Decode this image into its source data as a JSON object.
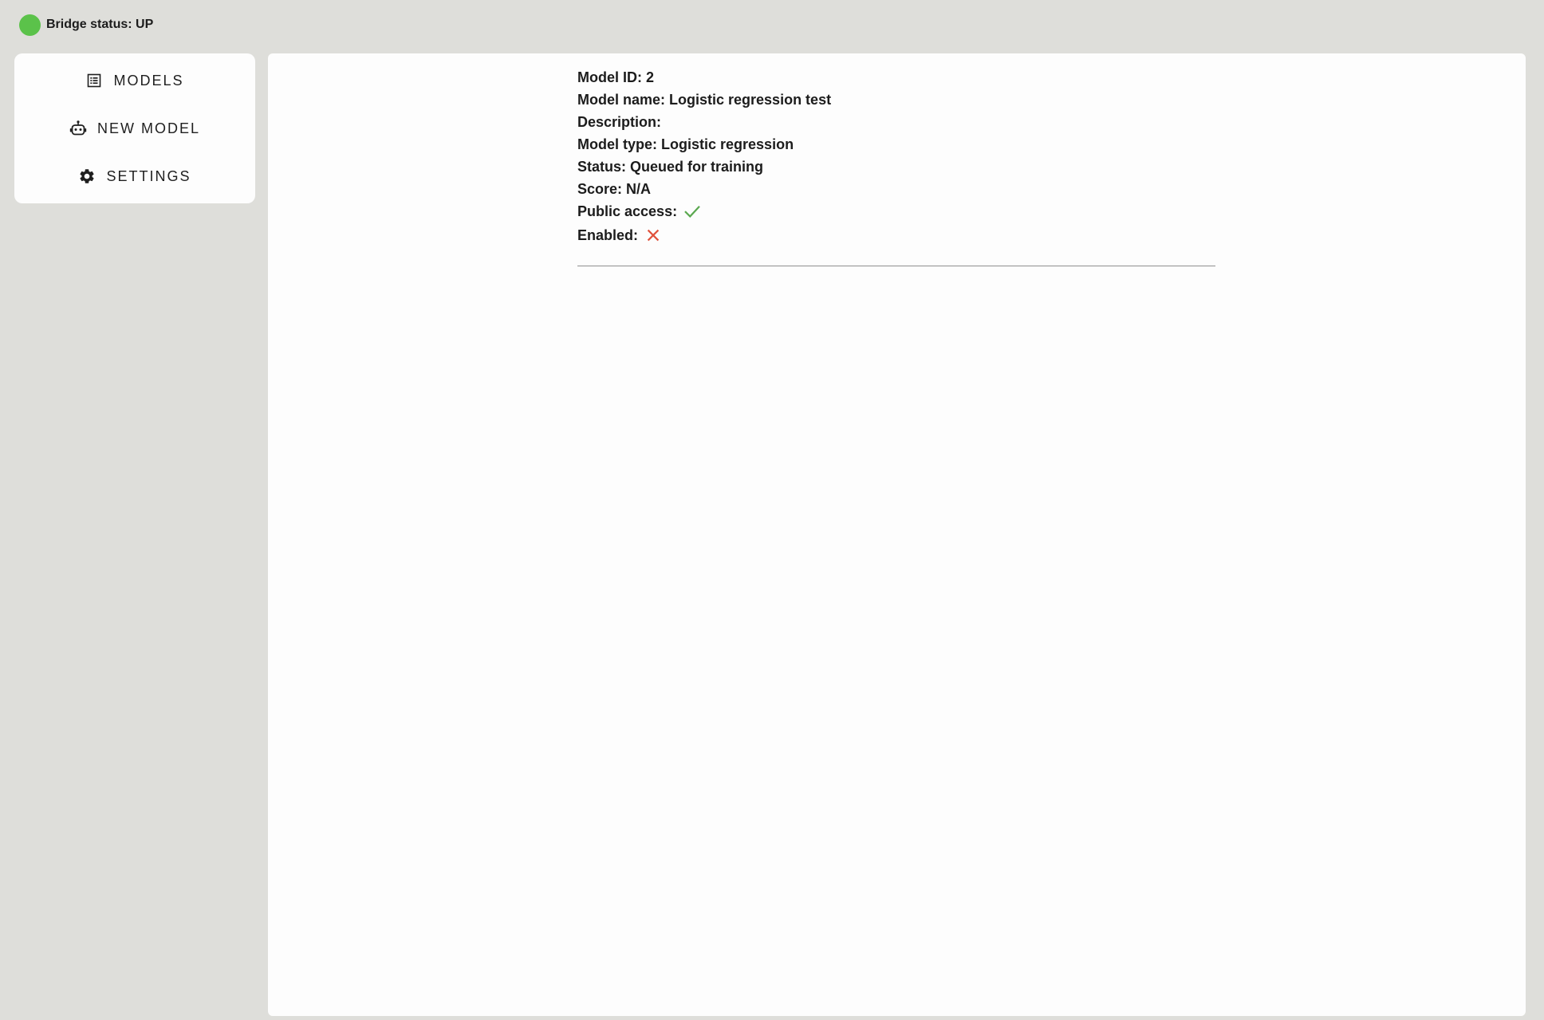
{
  "bridge": {
    "label": "Bridge status:",
    "value": "UP",
    "color": "#5bc24a"
  },
  "sidebar": {
    "items": [
      {
        "label": "MODELS",
        "icon": "list-icon"
      },
      {
        "label": "NEW MODEL",
        "icon": "robot-icon"
      },
      {
        "label": "SETTINGS",
        "icon": "gear-icon"
      }
    ]
  },
  "model": {
    "id_label": "Model ID:",
    "id": "2",
    "name_label": "Model name:",
    "name": "Logistic regression test",
    "description_label": "Description:",
    "description": "",
    "type_label": "Model type:",
    "type": "Logistic regression",
    "status_label": "Status:",
    "status": "Queued for training",
    "score_label": "Score:",
    "score": "N/A",
    "public_access_label": "Public access:",
    "public_access": true,
    "enabled_label": "Enabled:",
    "enabled": false,
    "true_color": "#5aa84f",
    "false_color": "#e0523c"
  }
}
